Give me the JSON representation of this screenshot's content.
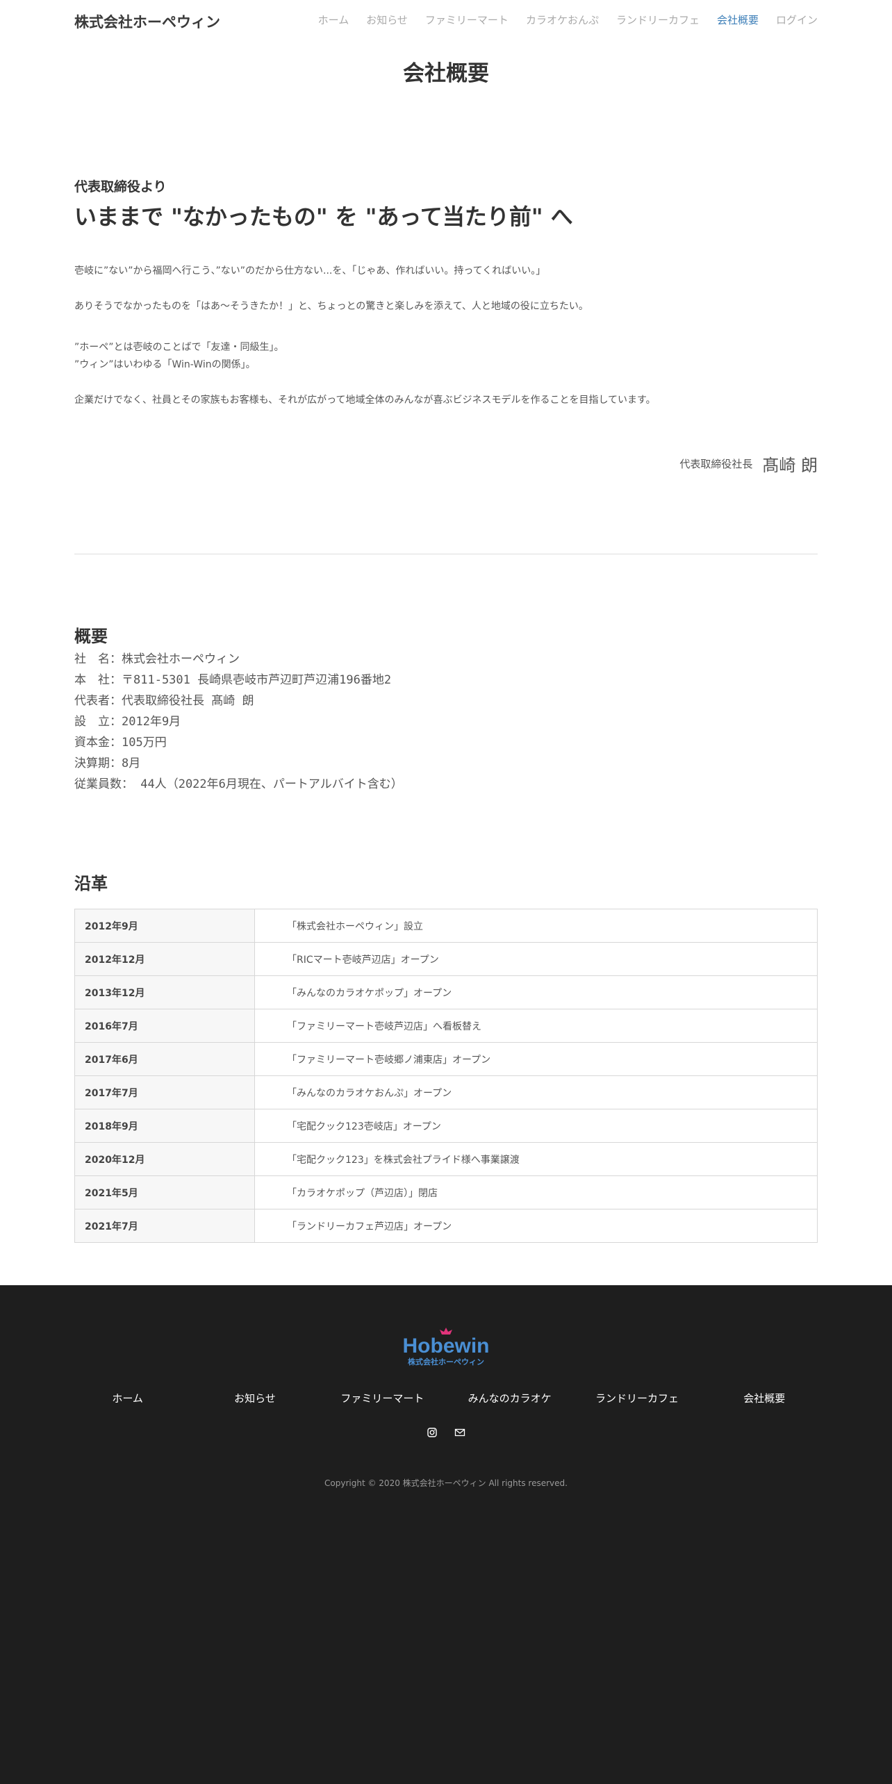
{
  "header": {
    "brand": "株式会社ホーペウィン",
    "nav": [
      "ホーム",
      "お知らせ",
      "ファミリーマート",
      "カラオケおんぷ",
      "ランドリーカフェ",
      "会社概要",
      "ログイン"
    ],
    "active_item": "会社概要"
  },
  "page_title": "会社概要",
  "message": {
    "subtitle": "代表取締役より",
    "headline": "いままで \"なかったもの\" を \"あって当たり前\" へ",
    "paragraphs": [
      "壱岐に”ない”から福岡へ行こう、”ない”のだから仕方ない...を、「じゃあ、作ればいい。持ってくればいい。」",
      "ありそうでなかったものを「はあ〜そうきたか！」と、ちょっとの驚きと楽しみを添えて、人と地域の役に立ちたい。",
      "”ホーペ”とは壱岐のことばで「友達・同級生」。",
      "”ウィン”はいわゆる「Win-Winの関係」。",
      "企業だけでなく、社員とその家族もお客様も、それが広がって地域全体のみんなが喜ぶビジネスモデルを作ることを目指しています。"
    ],
    "sign_role": "代表取締役社長",
    "sign_name": "髙崎 朗"
  },
  "overview": {
    "title": "概要",
    "lines": [
      "社　名：株式会社ホーペウィン",
      "本　社：〒811-5301 長崎県壱岐市芦辺町芦辺浦196番地2",
      "代表者：代表取締役社長 髙崎 朗",
      "設　立：2012年9月",
      "資本金：105万円",
      "決算期：8月",
      "従業員数： 44人（2022年6月現在、パートアルバイト含む）"
    ]
  },
  "history": {
    "title": "沿革",
    "rows": [
      {
        "date": "2012年9月",
        "event": "「株式会社ホーペウィン」設立"
      },
      {
        "date": "2012年12月",
        "event": "「RICマート壱岐芦辺店」オープン"
      },
      {
        "date": "2013年12月",
        "event": "「みんなのカラオケポップ」オープン"
      },
      {
        "date": "2016年7月",
        "event": "「ファミリーマート壱岐芦辺店」へ看板替え"
      },
      {
        "date": "2017年6月",
        "event": "「ファミリーマート壱岐郷ノ浦東店」オープン"
      },
      {
        "date": "2017年7月",
        "event": "「みんなのカラオケおんぷ」オープン"
      },
      {
        "date": "2018年9月",
        "event": "「宅配クック123壱岐店」オープン"
      },
      {
        "date": "2020年12月",
        "event": "「宅配クック123」を株式会社プライド様へ事業譲渡"
      },
      {
        "date": "2021年5月",
        "event": "「カラオケポップ（芦辺店）」閉店"
      },
      {
        "date": "2021年7月",
        "event": "「ランドリーカフェ芦辺店」オープン"
      }
    ]
  },
  "footer": {
    "logo_text": "Hobewin",
    "logo_sub": "株式会社ホーペウィン",
    "nav": [
      "ホーム",
      "お知らせ",
      "ファミリーマート",
      "みんなのカラオケ",
      "ランドリーカフェ",
      "会社概要"
    ],
    "icons": [
      "instagram-icon",
      "mail-icon"
    ],
    "copyright": "Copyright © 2020 株式会社ホーペウィン All rights reserved."
  },
  "colors": {
    "accent": "#3d7fb8",
    "footer_bg": "#1e1e1e",
    "logo_blue": "#4a8fd4",
    "logo_crown": "#e0337a"
  }
}
